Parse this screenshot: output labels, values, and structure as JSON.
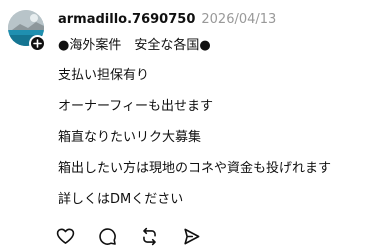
{
  "post": {
    "username": "armadillo.7690750",
    "timestamp": "2026/04/13",
    "bio": "●海外案件　安全な各国●",
    "lines": [
      "支払い担保有り",
      "オーナーフィーも出せます",
      "箱直なりたいリク大募集",
      "箱出したい方は現地のコネや資金も投げれます",
      "詳しくはDMください"
    ]
  },
  "icons": {
    "avatar": "avatar-photo",
    "follow": "plus-icon",
    "like": "heart-icon",
    "reply": "comment-icon",
    "repost": "repost-icon",
    "share": "send-icon"
  },
  "colors": {
    "text": "#101010",
    "muted": "#999999"
  }
}
